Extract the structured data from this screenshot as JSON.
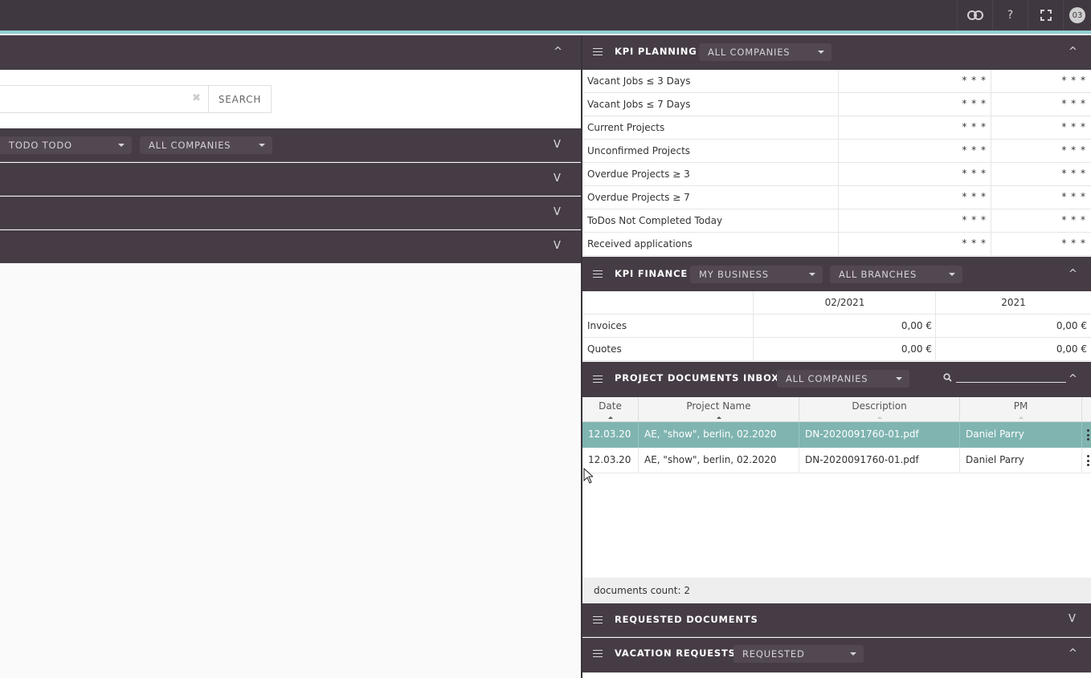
{
  "topbar": {
    "icons": [
      "link-icon",
      "help-icon",
      "fullscreen-icon"
    ],
    "help_glyph": "?",
    "avatar_initials": "03"
  },
  "left": {
    "search_button": "SEARCH",
    "filter_todo": "TODO TODO",
    "filter_companies": "ALL COMPANIES"
  },
  "kpi_planning": {
    "title": "KPI PLANNING",
    "company_filter": "ALL COMPANIES",
    "rows": [
      {
        "label": "Vacant Jobs ≤ 3 Days",
        "v1": "* * *",
        "v2": "* * *"
      },
      {
        "label": "Vacant Jobs ≤ 7 Days",
        "v1": "* * *",
        "v2": "* * *"
      },
      {
        "label": "Current Projects",
        "v1": "* * *",
        "v2": "* * *"
      },
      {
        "label": "Unconfirmed Projects",
        "v1": "* * *",
        "v2": "* * *"
      },
      {
        "label": "Overdue Projects ≥ 3",
        "v1": "* * *",
        "v2": "* * *"
      },
      {
        "label": "Overdue Projects ≥ 7",
        "v1": "* * *",
        "v2": "* * *"
      },
      {
        "label": "ToDos Not Completed Today",
        "v1": "* * *",
        "v2": "* * *"
      },
      {
        "label": "Received applications",
        "v1": "* * *",
        "v2": "* * *"
      }
    ]
  },
  "kpi_finance": {
    "title": "KPI FINANCE",
    "business_filter": "MY BUSINESS",
    "branch_filter": "ALL BRANCHES",
    "col1": "02/2021",
    "col2": "2021",
    "rows": [
      {
        "label": "Invoices",
        "v1": "0,00 €",
        "v2": "0,00 €"
      },
      {
        "label": "Quotes",
        "v1": "0,00 €",
        "v2": "0,00 €"
      }
    ]
  },
  "docs_inbox": {
    "title": "PROJECT DOCUMENTS INBOX",
    "company_filter": "ALL COMPANIES",
    "columns": [
      "Date",
      "Project Name",
      "Description",
      "PM"
    ],
    "rows": [
      {
        "date": "12.03.20",
        "project": "AE, \"show\", berlin, 02.2020",
        "description": "DN-2020091760-01.pdf",
        "pm": "Daniel Parry"
      },
      {
        "date": "12.03.20",
        "project": "AE, \"show\", berlin, 02.2020",
        "description": "DN-2020091760-01.pdf",
        "pm": "Daniel Parry"
      }
    ],
    "footer": "documents count: 2"
  },
  "requested_docs": {
    "title": "REQUESTED DOCUMENTS"
  },
  "vacation": {
    "title": "VACATION REQUESTS",
    "status_filter": "REQUESTED"
  },
  "glyphs": {
    "up": "^",
    "down": "V",
    "clear": "✖"
  }
}
